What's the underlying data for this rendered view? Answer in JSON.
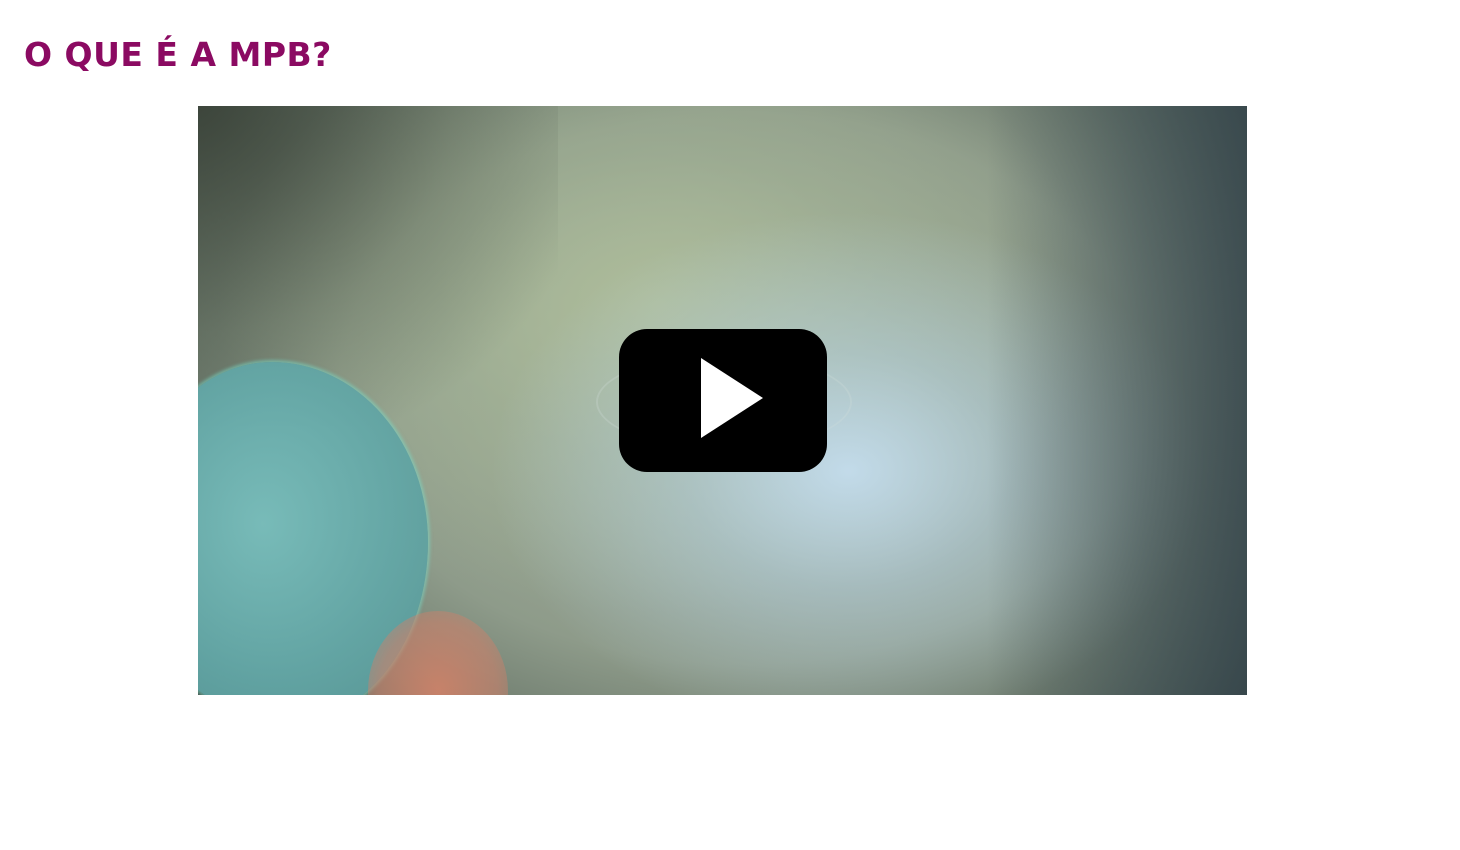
{
  "page": {
    "title": "O QUE É A MPB?"
  },
  "video": {
    "play_icon": "play-icon"
  },
  "colors": {
    "title": "#8b0a62",
    "play_button_bg": "#000000",
    "play_icon": "#ffffff"
  }
}
